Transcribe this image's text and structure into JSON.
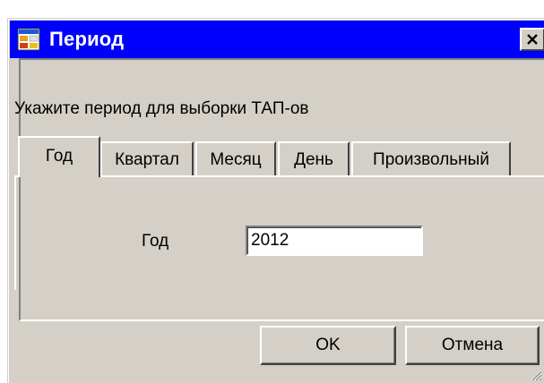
{
  "window": {
    "title": "Период",
    "icon": "app-form-icon",
    "close_icon": "close-icon"
  },
  "prompt": "Укажите период для выборки ТАП-ов",
  "tabs": [
    {
      "label": "Год",
      "active": true
    },
    {
      "label": "Квартал",
      "active": false
    },
    {
      "label": "Месяц",
      "active": false
    },
    {
      "label": "День",
      "active": false
    },
    {
      "label": "Произвольный",
      "active": false
    }
  ],
  "year_tab": {
    "field_label": "Год",
    "field_value": "2012"
  },
  "buttons": {
    "ok_label": "OK",
    "cancel_label": "Отмена"
  },
  "colors": {
    "titlebar": "#0000ff",
    "face": "#d4d0c8"
  }
}
